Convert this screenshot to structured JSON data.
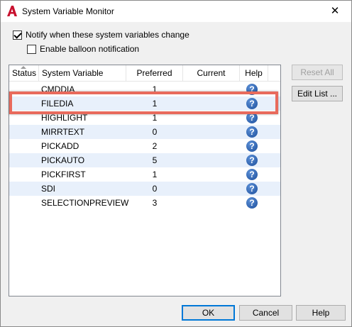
{
  "window": {
    "title": "System Variable Monitor",
    "close_glyph": "✕"
  },
  "options": {
    "notify_label": "Notify when these system variables change",
    "notify_checked": true,
    "balloon_label": "Enable balloon notification",
    "balloon_checked": false
  },
  "table": {
    "columns": [
      "Status",
      "System Variable",
      "Preferred",
      "Current",
      "Help"
    ],
    "rows": [
      {
        "name": "CMDDIA",
        "preferred": "1",
        "current": ""
      },
      {
        "name": "FILEDIA",
        "preferred": "1",
        "current": ""
      },
      {
        "name": "HIGHLIGHT",
        "preferred": "1",
        "current": ""
      },
      {
        "name": "MIRRTEXT",
        "preferred": "0",
        "current": ""
      },
      {
        "name": "PICKADD",
        "preferred": "2",
        "current": ""
      },
      {
        "name": "PICKAUTO",
        "preferred": "5",
        "current": ""
      },
      {
        "name": "PICKFIRST",
        "preferred": "1",
        "current": ""
      },
      {
        "name": "SDI",
        "preferred": "0",
        "current": ""
      },
      {
        "name": "SELECTIONPREVIEW",
        "preferred": "3",
        "current": ""
      }
    ],
    "help_glyph": "?"
  },
  "buttons": {
    "reset_all": "Reset All",
    "edit_list": "Edit List ...",
    "ok": "OK",
    "cancel": "Cancel",
    "help": "Help"
  },
  "colors": {
    "highlight_border": "#e86a5c",
    "alt_row": "#e8f0fb",
    "app_icon_red": "#c8102e"
  }
}
